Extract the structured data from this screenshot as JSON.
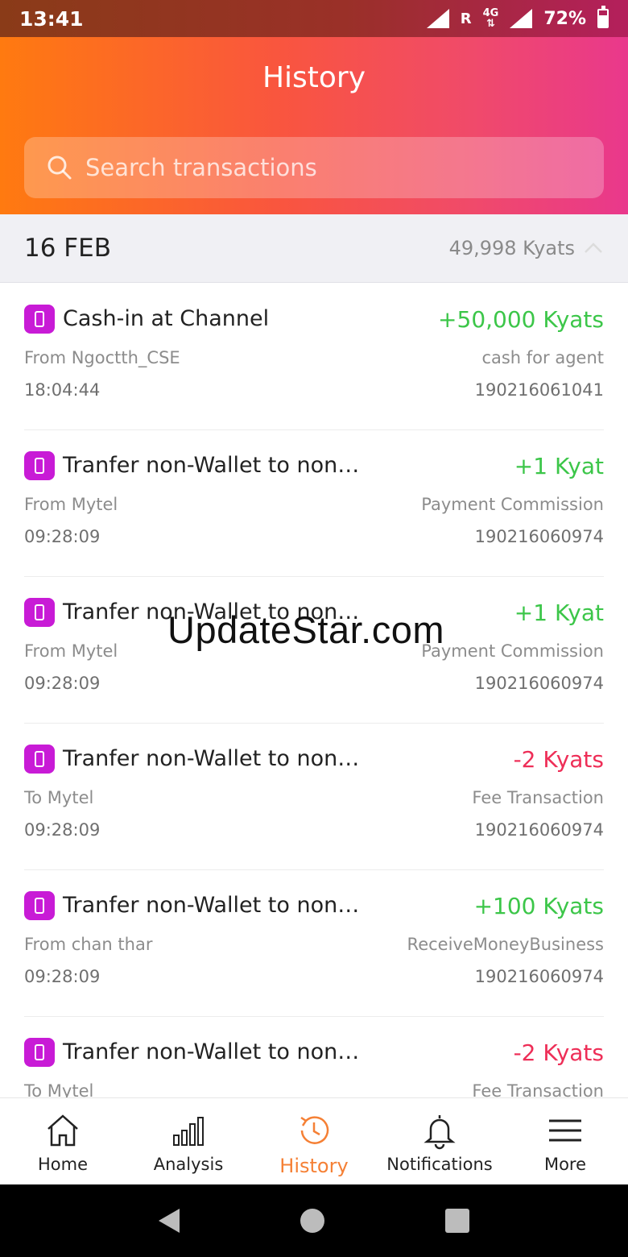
{
  "status_bar": {
    "time": "13:41",
    "roaming": "R",
    "network": "4G",
    "battery": "72%"
  },
  "header": {
    "title": "History"
  },
  "search": {
    "placeholder": "Search transactions"
  },
  "date_group": {
    "date": "16 FEB",
    "total": "49,998 Kyats"
  },
  "transactions": [
    {
      "title": "Cash-in at Channel",
      "amount": "+50,000 Kyats",
      "direction": "positive",
      "party": "From Ngoctth_CSE",
      "category": "cash for agent",
      "time": "18:04:44",
      "id": "190216061041"
    },
    {
      "title": "Tranfer non-Wallet to non…",
      "amount": "+1 Kyat",
      "direction": "positive",
      "party": "From Mytel",
      "category": "Payment Commission",
      "time": "09:28:09",
      "id": "190216060974"
    },
    {
      "title": "Tranfer non-Wallet to non…",
      "amount": "+1 Kyat",
      "direction": "positive",
      "party": "From Mytel",
      "category": "Payment Commission",
      "time": "09:28:09",
      "id": "190216060974"
    },
    {
      "title": "Tranfer non-Wallet to non…",
      "amount": "-2 Kyats",
      "direction": "negative",
      "party": "To Mytel",
      "category": "Fee Transaction",
      "time": "09:28:09",
      "id": "190216060974"
    },
    {
      "title": "Tranfer non-Wallet to non…",
      "amount": "+100 Kyats",
      "direction": "positive",
      "party": "From chan thar",
      "category": "ReceiveMoneyBusiness",
      "time": "09:28:09",
      "id": "190216060974"
    },
    {
      "title": "Tranfer non-Wallet to non…",
      "amount": "-2 Kyats",
      "direction": "negative",
      "party": "To Mytel",
      "category": "Fee Transaction",
      "time": "",
      "id": ""
    }
  ],
  "watermark": "UpdateStar.com",
  "bottom_nav": [
    {
      "label": "Home",
      "icon": "home-icon"
    },
    {
      "label": "Analysis",
      "icon": "bar-chart-icon"
    },
    {
      "label": "History",
      "icon": "history-icon",
      "active": true
    },
    {
      "label": "Notifications",
      "icon": "bell-icon"
    },
    {
      "label": "More",
      "icon": "menu-icon"
    }
  ],
  "colors": {
    "positive": "#3cc649",
    "negative": "#ee2e57",
    "active_nav": "#f58035",
    "badge": "#c81bd6"
  }
}
